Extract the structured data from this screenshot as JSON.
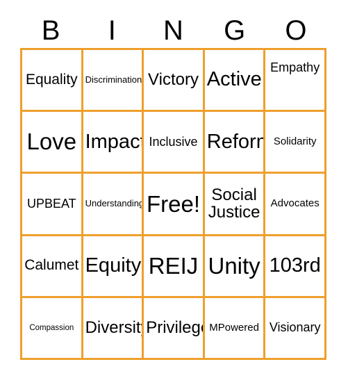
{
  "card": {
    "title": "BINGO",
    "header_letters": [
      "B",
      "I",
      "N",
      "G",
      "O"
    ],
    "colors": {
      "grid_border": "#ee9f2d",
      "cell_background": "#ffffff",
      "text": "#000000",
      "page_background": "#ffffff"
    },
    "grid": {
      "columns": 5,
      "rows": 5,
      "free_space": "Free!"
    },
    "cells": [
      {
        "label": "Equality",
        "row": 1,
        "column": "B",
        "size": "l",
        "align": "middle"
      },
      {
        "label": "Discrimination",
        "row": 1,
        "column": "I",
        "size": "xs",
        "align": "middle"
      },
      {
        "label": "Victory",
        "row": 1,
        "column": "N",
        "size": "xl",
        "align": "middle"
      },
      {
        "label": "Active",
        "row": 1,
        "column": "G",
        "size": "xxl",
        "align": "middle"
      },
      {
        "label": "Empathy",
        "row": 1,
        "column": "O",
        "size": "m",
        "align": "top"
      },
      {
        "label": "Love",
        "row": 2,
        "column": "B",
        "size": "3xl",
        "align": "middle"
      },
      {
        "label": "Impact",
        "row": 2,
        "column": "I",
        "size": "xxl",
        "align": "middle"
      },
      {
        "label": "Inclusive",
        "row": 2,
        "column": "N",
        "size": "m",
        "align": "middle"
      },
      {
        "label": "Reform",
        "row": 2,
        "column": "G",
        "size": "xxl",
        "align": "middle"
      },
      {
        "label": "Solidarity",
        "row": 2,
        "column": "O",
        "size": "s",
        "align": "middle"
      },
      {
        "label": "UPBEAT",
        "row": 3,
        "column": "B",
        "size": "m",
        "align": "middle"
      },
      {
        "label": "Understanding",
        "row": 3,
        "column": "I",
        "size": "xs",
        "align": "middle"
      },
      {
        "label": "Free!",
        "row": 3,
        "column": "N",
        "size": "3xl",
        "align": "middle"
      },
      {
        "label": "Social\nJustice",
        "row": 3,
        "column": "G",
        "size": "xl",
        "align": "middle"
      },
      {
        "label": "Advocates",
        "row": 3,
        "column": "O",
        "size": "s",
        "align": "middle"
      },
      {
        "label": "Calumet",
        "row": 4,
        "column": "B",
        "size": "l",
        "align": "middle"
      },
      {
        "label": "Equity",
        "row": 4,
        "column": "I",
        "size": "xxl",
        "align": "middle"
      },
      {
        "label": "REIJ",
        "row": 4,
        "column": "N",
        "size": "3xl",
        "align": "middle"
      },
      {
        "label": "Unity",
        "row": 4,
        "column": "G",
        "size": "3xl",
        "align": "middle"
      },
      {
        "label": "103rd",
        "row": 4,
        "column": "O",
        "size": "xxl",
        "align": "middle"
      },
      {
        "label": "Compassion",
        "row": 5,
        "column": "B",
        "size": "xxs",
        "align": "middle"
      },
      {
        "label": "Diversity",
        "row": 5,
        "column": "I",
        "size": "xl",
        "align": "middle"
      },
      {
        "label": "Privilege",
        "row": 5,
        "column": "N",
        "size": "xl",
        "align": "middle"
      },
      {
        "label": "MPowered",
        "row": 5,
        "column": "G",
        "size": "s",
        "align": "middle"
      },
      {
        "label": "Visionary",
        "row": 5,
        "column": "O",
        "size": "m",
        "align": "middle"
      }
    ]
  }
}
